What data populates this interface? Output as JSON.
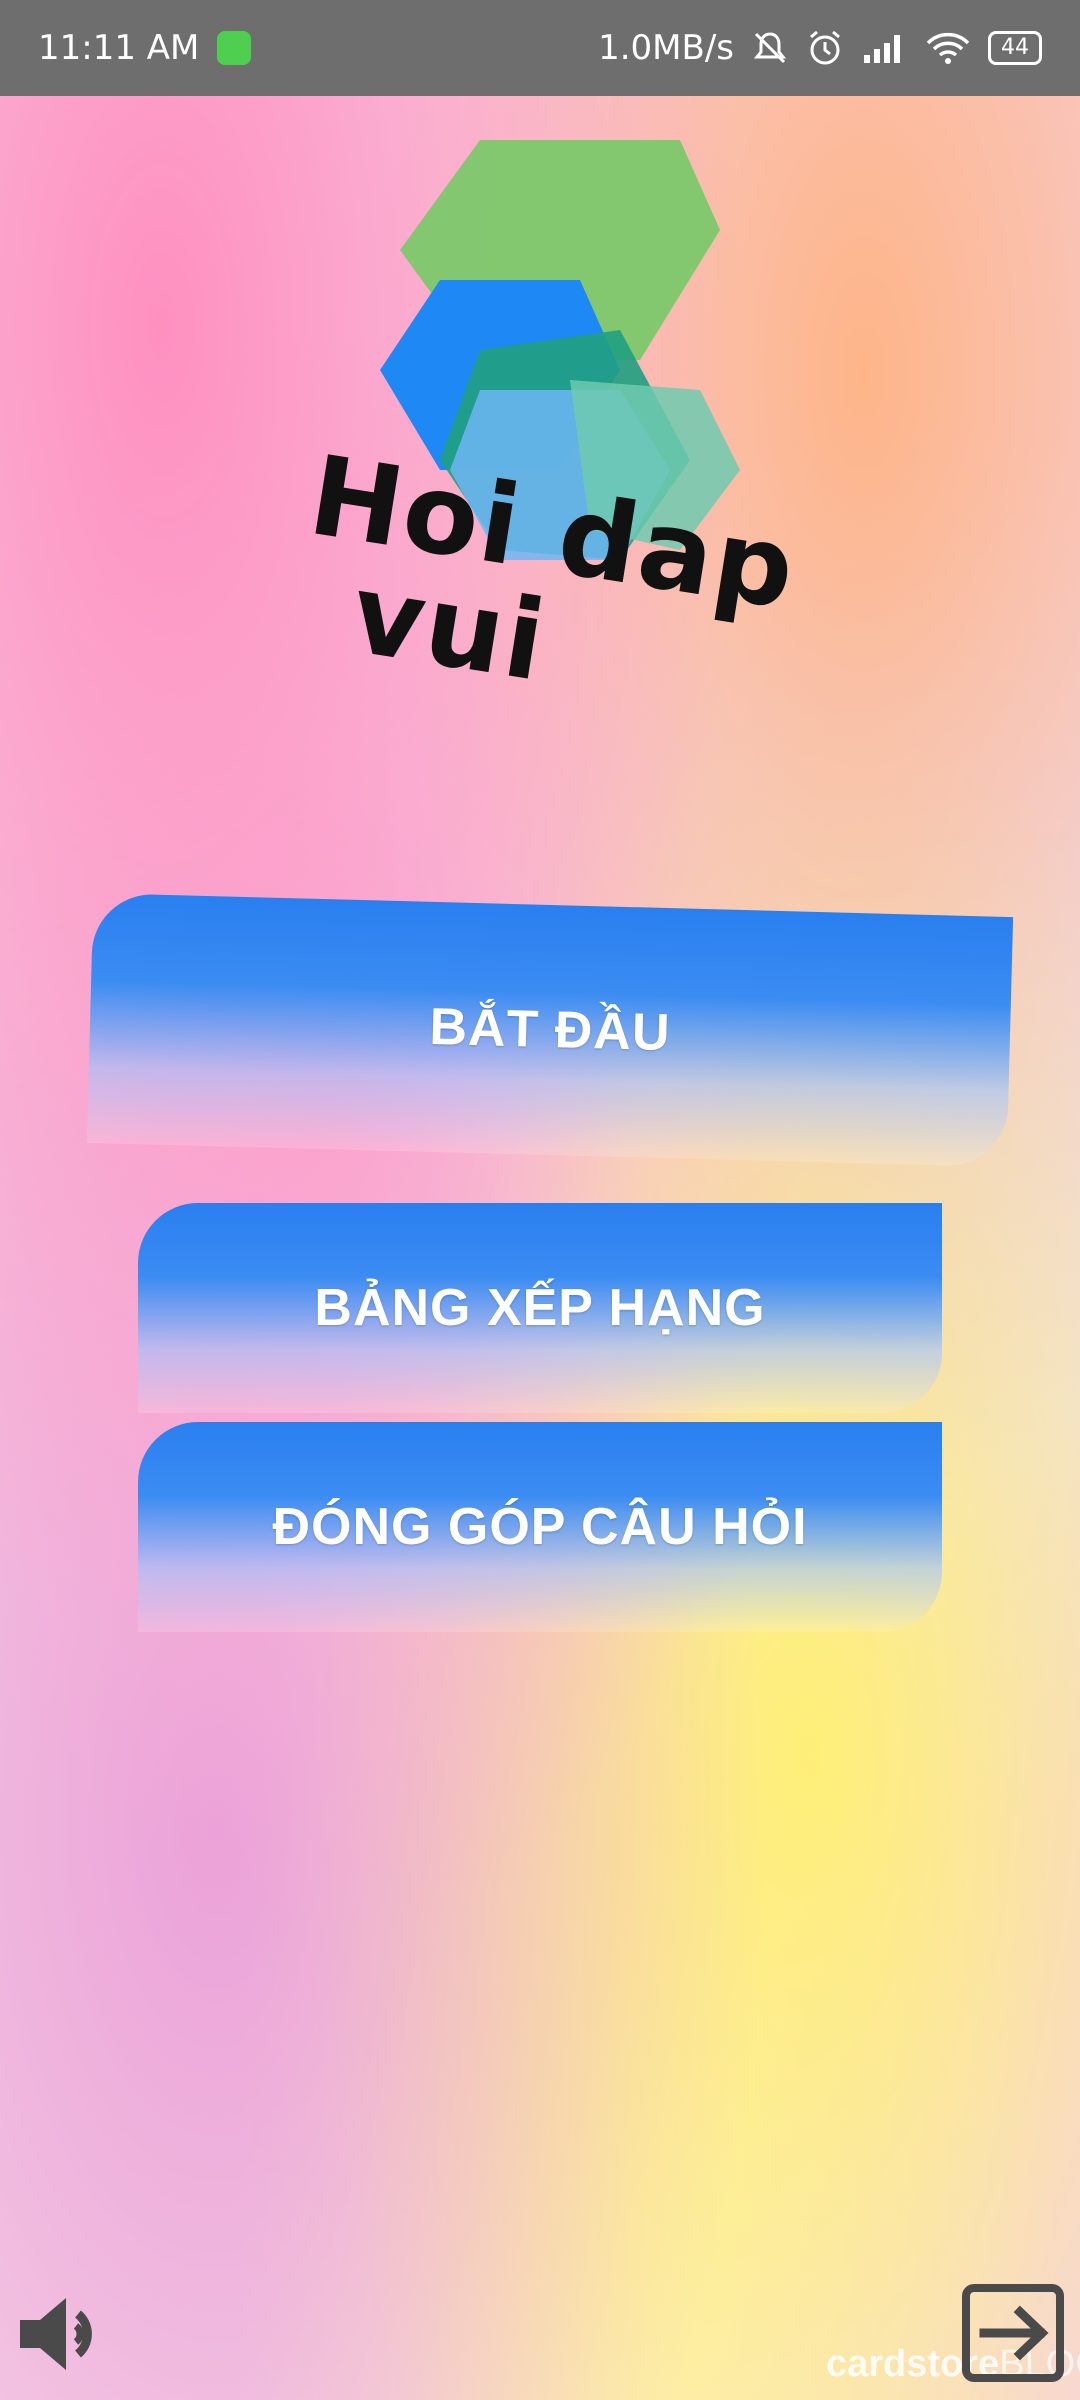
{
  "status_bar": {
    "time": "11:11 AM",
    "network_speed": "1.0MB/s",
    "battery": "44",
    "icons": [
      "app-notification-icon",
      "mute-icon",
      "alarm-icon",
      "signal-icon",
      "wifi-icon",
      "battery-icon"
    ]
  },
  "logo": {
    "line1": "Hoi dap",
    "line2": "vui",
    "colors": {
      "green": "#7cc86a",
      "blue": "#1e88f5",
      "teal": "#20a080",
      "light_blue": "#6db6f5"
    }
  },
  "menu": {
    "start_label": "BẮT ĐẦU",
    "leaderboard_label": "BẢNG XẾP HẠNG",
    "contribute_label": "ĐÓNG GÓP CÂU HỎI"
  },
  "footer": {
    "sound_icon": "speaker-icon",
    "exit_icon": "exit-icon",
    "watermark": "cardstore",
    "watermark_suffix": "BLOG"
  },
  "colors": {
    "button_top": "#2a7ff0",
    "status_bar": "#6e6e6e"
  }
}
